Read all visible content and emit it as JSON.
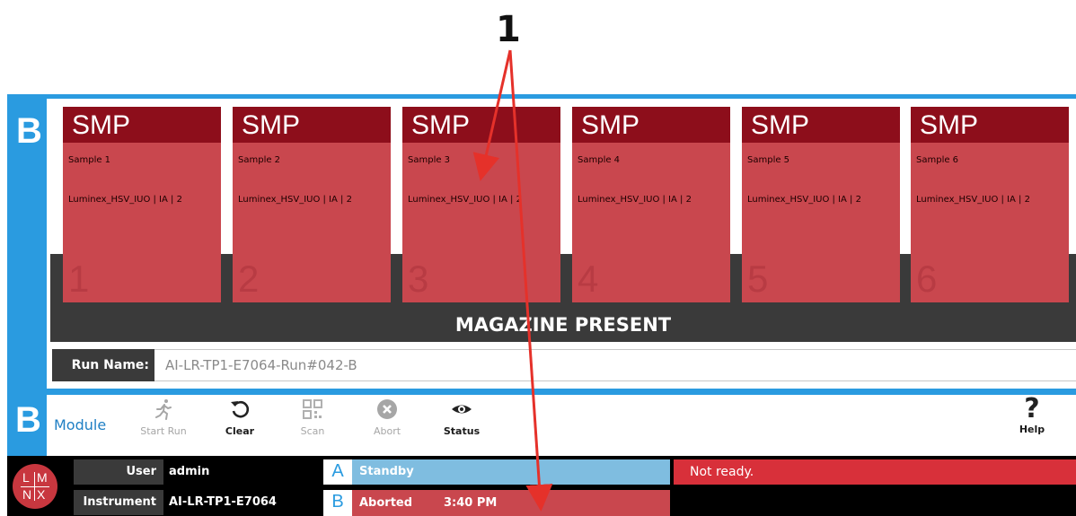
{
  "annotation": {
    "callout": "1"
  },
  "module": {
    "letter": "B"
  },
  "magazine": {
    "status_label": "MAGAZINE PRESENT",
    "slots": [
      {
        "header": "SMP",
        "sample": "Sample 1",
        "assay": "Luminex_HSV_IUO | IA | 2",
        "number": "1"
      },
      {
        "header": "SMP",
        "sample": "Sample 2",
        "assay": "Luminex_HSV_IUO | IA | 2",
        "number": "2"
      },
      {
        "header": "SMP",
        "sample": "Sample 3",
        "assay": "Luminex_HSV_IUO | IA | 2",
        "number": "3"
      },
      {
        "header": "SMP",
        "sample": "Sample 4",
        "assay": "Luminex_HSV_IUO | IA | 2",
        "number": "4"
      },
      {
        "header": "SMP",
        "sample": "Sample 5",
        "assay": "Luminex_HSV_IUO | IA | 2",
        "number": "5"
      },
      {
        "header": "SMP",
        "sample": "Sample 6",
        "assay": "Luminex_HSV_IUO | IA | 2",
        "number": "6"
      }
    ]
  },
  "run": {
    "label": "Run Name:",
    "value": "AI-LR-TP1-E7064-Run#042-B"
  },
  "toolbar": {
    "module_letter": "B",
    "module_label": "Module",
    "start_run": "Start Run",
    "clear": "Clear",
    "scan": "Scan",
    "abort": "Abort",
    "status": "Status",
    "help": "Help",
    "help_glyph": "?"
  },
  "statusbar": {
    "logo": {
      "tl": "L",
      "tr": "M",
      "bl": "N",
      "br": "X"
    },
    "user_label": "User",
    "user_value": "admin",
    "instrument_label": "Instrument",
    "instrument_value": "AI-LR-TP1-E7064",
    "module_a": {
      "letter": "A",
      "state": "Standby",
      "time": ""
    },
    "module_b": {
      "letter": "B",
      "state": "Aborted",
      "time": "3:40 PM"
    },
    "message": "Not ready."
  },
  "colors": {
    "accent_blue": "#2a9be0",
    "slot_header": "#8d0e1b",
    "slot_body": "#c9474e",
    "standby": "#7fbde0",
    "aborted": "#c9474e",
    "not_ready": "#d8303a"
  }
}
